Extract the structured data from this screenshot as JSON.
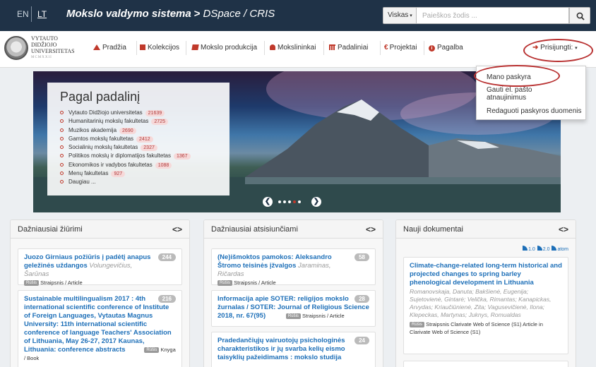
{
  "header": {
    "lang_en": "EN",
    "lang_lt": "LT",
    "brand_main": "Mokslo valdymo sistema",
    "brand_arrow": ">",
    "brand_sub": "DSpace / CRIS",
    "scope": "Viskas",
    "search_placeholder": "Paieškos žodis ...",
    "search_icon": "search-icon"
  },
  "logo": {
    "line1": "VYTAUTO",
    "line2": "DIDŽIOJO",
    "line3": "UNIVERSITETAS",
    "line4": "MCMXXII"
  },
  "nav": {
    "items": [
      {
        "label": "Pradžia",
        "icon": "home-icon"
      },
      {
        "label": "Kolekcijos",
        "icon": "folder-icon"
      },
      {
        "label": "Mokslo produkcija",
        "icon": "book-icon"
      },
      {
        "label": "Mokslininkai",
        "icon": "user-icon"
      },
      {
        "label": "Padaliniai",
        "icon": "institution-icon"
      },
      {
        "label": "Projektai",
        "icon": "euro-icon"
      },
      {
        "label": "Pagalba",
        "icon": "info-icon"
      }
    ],
    "login": "Prisijungti:",
    "login_caret": "▾"
  },
  "dropdown": {
    "items": [
      "Mano paskyra",
      "Gauti el. pašto atnaujinimus",
      "Redaguoti paskyros duomenis"
    ]
  },
  "banner": {
    "title": "Pagal padalinį",
    "items": [
      {
        "label": "Vytauto Didžiojo universitetas",
        "count": "21639"
      },
      {
        "label": "Humanitarinių mokslų fakultetas",
        "count": "2725"
      },
      {
        "label": "Muzikos akademija",
        "count": "2690"
      },
      {
        "label": "Gamtos mokslų fakultetas",
        "count": "2412"
      },
      {
        "label": "Socialinių mokslų fakultetas",
        "count": "2327"
      },
      {
        "label": "Politikos mokslų ir diplomatijos fakultetas",
        "count": "1367"
      },
      {
        "label": "Ekonomikos ir vadybos fakultetas",
        "count": "1088"
      },
      {
        "label": "Menų fakultetas",
        "count": "927"
      },
      {
        "label": "Daugiau ...",
        "count": ""
      }
    ],
    "prev": "❮",
    "next": "❯"
  },
  "columns": {
    "viewed": {
      "title": "Dažniausiai žiūrimi",
      "chev": "<>",
      "cards": [
        {
          "title": "Juozo Girniaus požiūris į padėtį anapus geležinės uždangos",
          "authors": "Volungevičius, Šarūnas",
          "count": "244",
          "badge": "Rūšis",
          "type": "Straipsnis / Article"
        },
        {
          "title": "Sustainable multilingualism 2017 : 4th international scientific conference of Institute of Foreign Languages, Vytautas Magnus University: 11th international scientific conference of language Teachers' Association of Lithuania, May 26-27, 2017 Kaunas, Lithuania: conference abstracts",
          "authors": "",
          "count": "216",
          "badge": "Rūšis",
          "type": "Knyga / Book"
        }
      ]
    },
    "downloaded": {
      "title": "Dažniausiai atsisiunčiami",
      "chev": "<>",
      "cards": [
        {
          "title": "(Ne)išmoktos pamokos: Aleksandro Štromo teisinės įžvalgos",
          "authors": "Jaraminas, Ričardas",
          "count": "58",
          "badge": "Rūšis",
          "type": "Straipsnis / Article"
        },
        {
          "title": "Informacija apie SOTER: religijos mokslo žurnalas / SOTER: Journal of Religious Science 2018, nr. 67(95)",
          "authors": "",
          "count": "28",
          "badge": "Rūšis",
          "type": "Straipsnis / Article"
        },
        {
          "title": "Pradedančiųjų vairuotojų psichologinės charakteristikos ir jų svarba kelių eismo taisyklių pažeidimams : mokslo studija",
          "authors": "",
          "count": "24",
          "badge": "",
          "type": ""
        }
      ]
    },
    "recent": {
      "title": "Nauji dokumentai",
      "chev": "<>",
      "feeds": [
        "1.0",
        "2.0",
        "atom"
      ],
      "card": {
        "title": "Climate-change-related long-term historical and projected changes to spring barley phenological development in Lithuania",
        "authors": "Romanovskaja, Danuta; Bakšienė, Eugenija; Sujetovienė, Gintarė; Velička, Rimantas; Kanapickas, Arvydas; Kriaučiūnienė, Zita; Vagusevičienė, Ilona; Klepeckas, Martynas; Juknys, Romualdas",
        "badge": "Rūšis",
        "type": "Straipsnis Clarivate Web of Science (S1) Article in Clarivate Web of Science (S1)"
      }
    }
  }
}
